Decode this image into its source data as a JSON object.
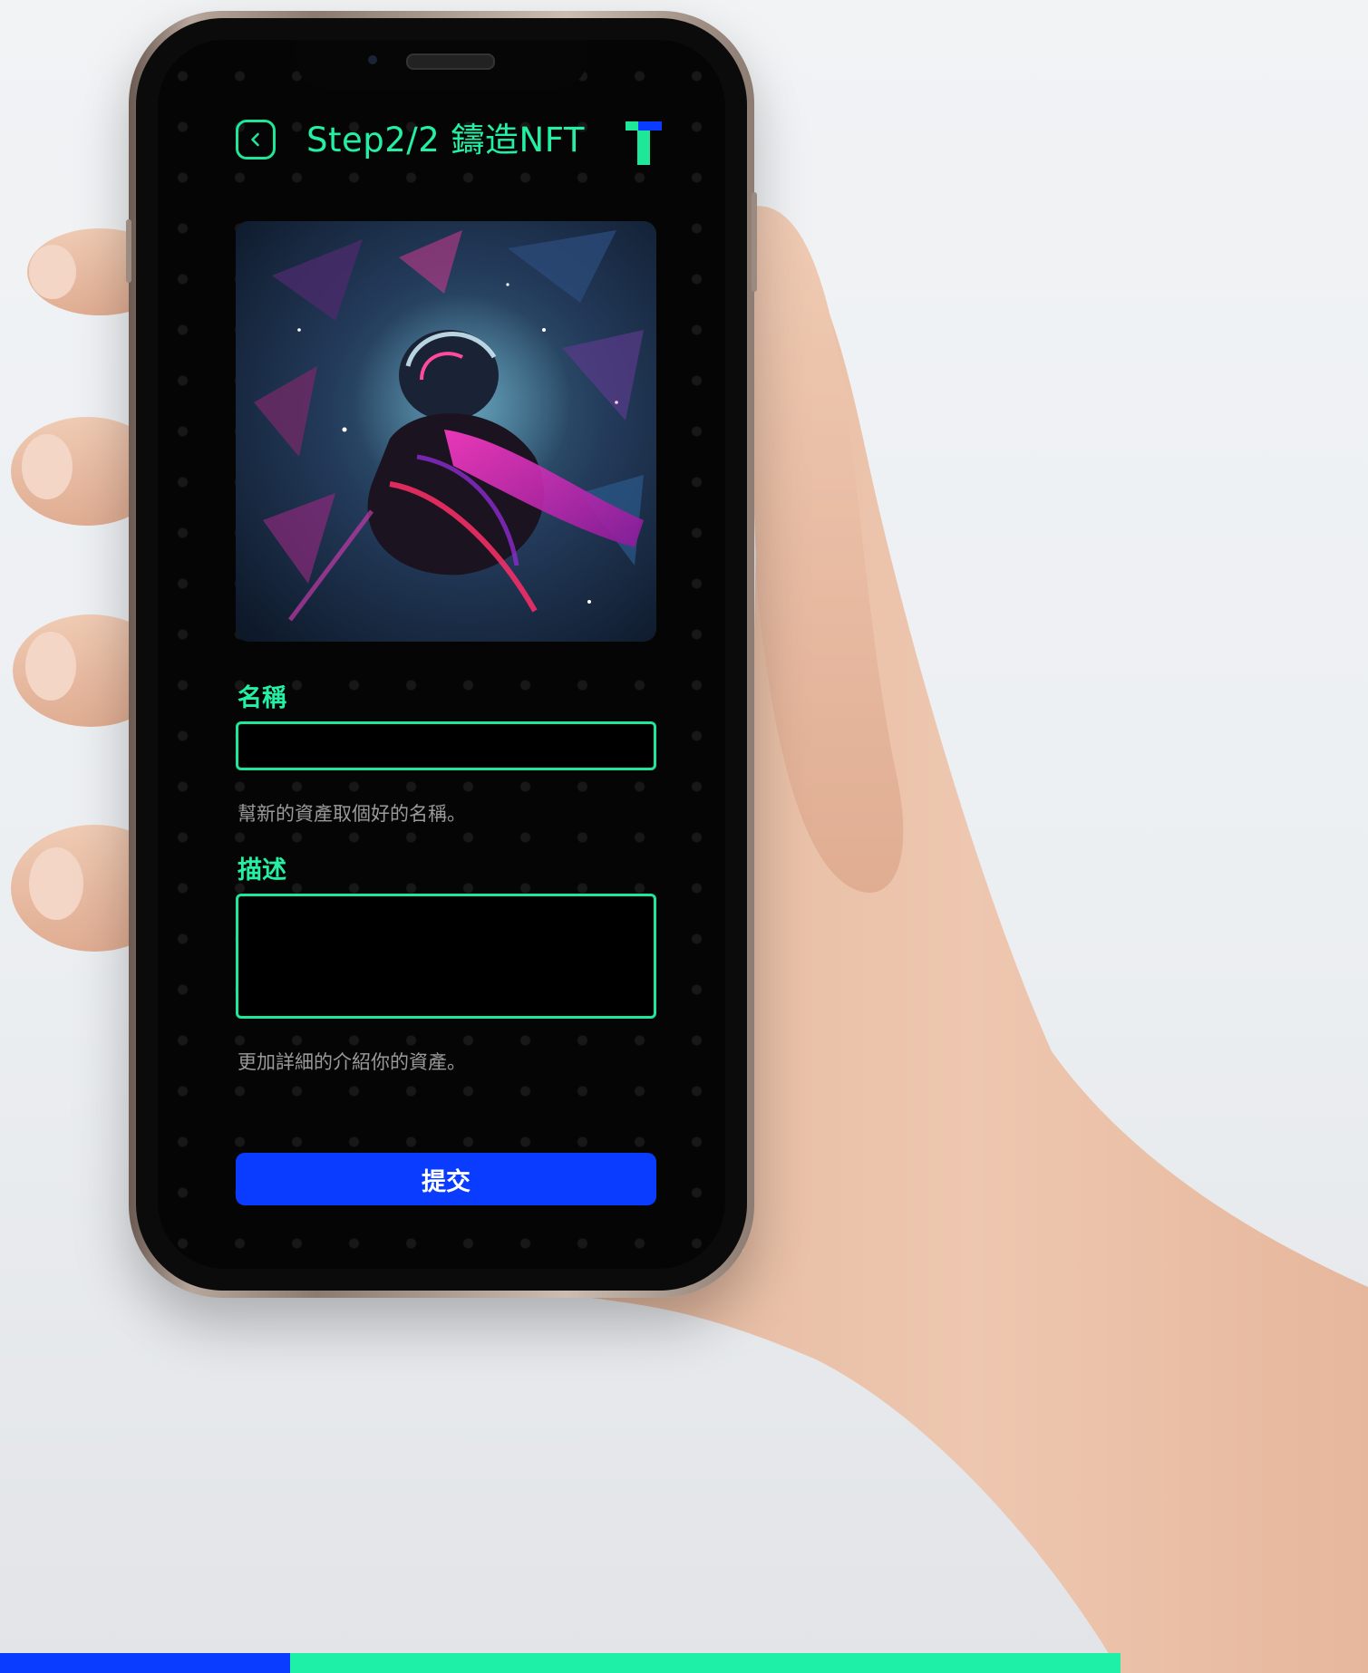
{
  "app": {
    "title": "Step2/2 鑄造NFT",
    "back_icon": "chevron-left-icon",
    "logo_icon": "t-logo-icon"
  },
  "form": {
    "name": {
      "label": "名稱",
      "value": "",
      "hint": "幫新的資產取個好的名稱。"
    },
    "description": {
      "label": "描述",
      "value": "",
      "hint": "更加詳細的介紹你的資產。"
    },
    "submit_label": "提交"
  },
  "colors": {
    "accent_green": "#24f0a4",
    "accent_blue": "#0a3cff",
    "screen_bg": "#050505"
  }
}
